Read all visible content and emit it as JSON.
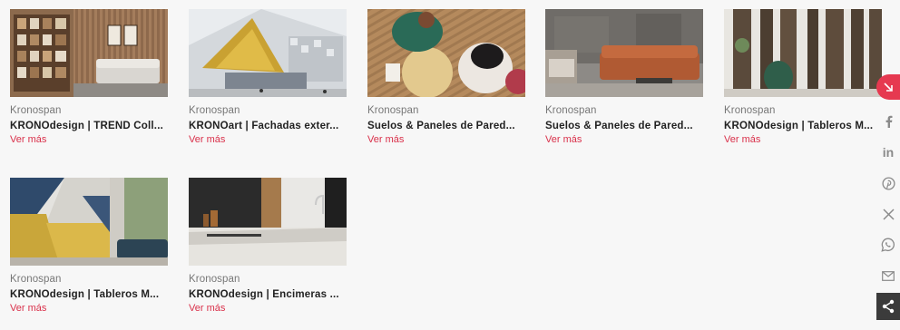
{
  "cards": [
    {
      "brand": "Kronospan",
      "title": "KRONOdesign | TREND Coll...",
      "link": "Ver más"
    },
    {
      "brand": "Kronospan",
      "title": "KRONOart | Fachadas exter...",
      "link": "Ver más"
    },
    {
      "brand": "Kronospan",
      "title": "Suelos & Paneles de Pared...",
      "link": "Ver más"
    },
    {
      "brand": "Kronospan",
      "title": "Suelos & Paneles de Pared...",
      "link": "Ver más"
    },
    {
      "brand": "Kronospan",
      "title": "KRONOdesign | Tableros M...",
      "link": "Ver más"
    },
    {
      "brand": "Kronospan",
      "title": "KRONOdesign | Tableros M...",
      "link": "Ver más"
    },
    {
      "brand": "Kronospan",
      "title": "KRONOdesign | Encimeras ...",
      "link": "Ver más"
    }
  ],
  "share": {
    "icons": [
      "arrow-down-right-icon",
      "facebook-icon",
      "linkedin-icon",
      "pinterest-icon",
      "x-icon",
      "whatsapp-icon",
      "email-icon",
      "share-icon"
    ],
    "linkedin_text": "in",
    "accent": "#e63950",
    "toggle_bg": "#3b3b3b"
  },
  "colors": {
    "link": "#d9304a",
    "brand_text": "#777777",
    "title_text": "#222222"
  }
}
